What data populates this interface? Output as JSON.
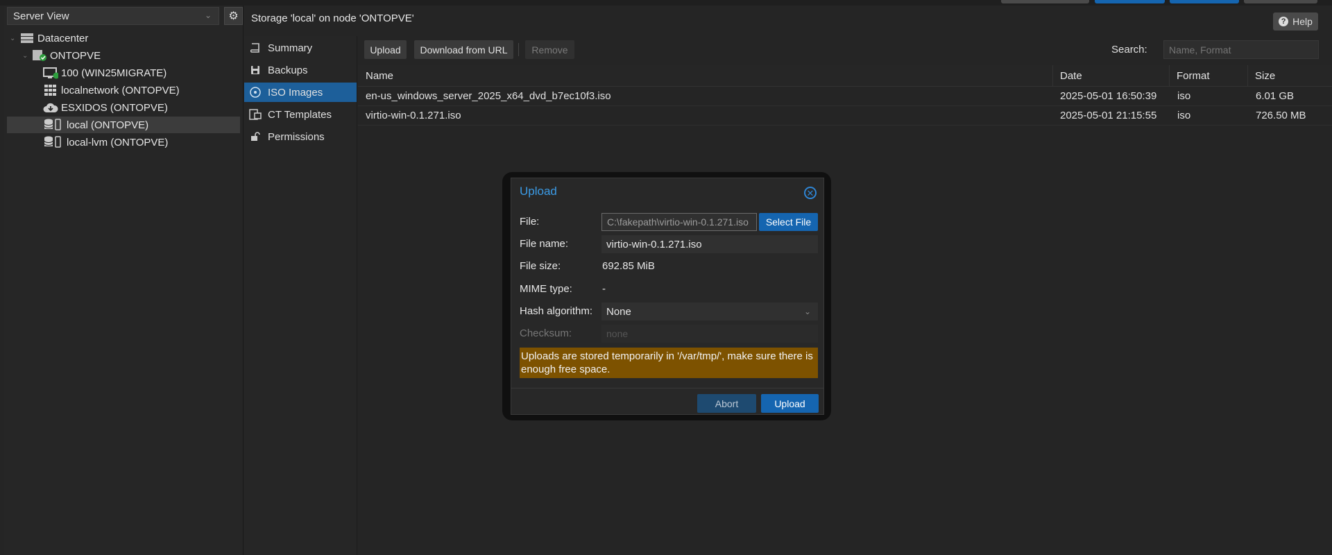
{
  "left_panel": {
    "view_select": "Server View",
    "tree": [
      {
        "label": "Datacenter",
        "icon": "datacenter-icon"
      },
      {
        "label": "ONTOPVE",
        "icon": "node-online-icon"
      },
      {
        "label": "100 (WIN25MIGRATE)",
        "icon": "vm-running-icon"
      },
      {
        "label": "localnetwork (ONTOPVE)",
        "icon": "grid-network-icon"
      },
      {
        "label": "ESXIDOS (ONTOPVE)",
        "icon": "cloud-storage-icon"
      },
      {
        "label": "local (ONTOPVE)",
        "icon": "storage-icon"
      },
      {
        "label": "local-lvm (ONTOPVE)",
        "icon": "storage-icon"
      }
    ]
  },
  "content": {
    "title": "Storage 'local' on node 'ONTOPVE'",
    "help_label": "Help",
    "nav": [
      {
        "label": "Summary",
        "icon": "book-icon"
      },
      {
        "label": "Backups",
        "icon": "floppy-icon"
      },
      {
        "label": "ISO Images",
        "icon": "disc-icon"
      },
      {
        "label": "CT Templates",
        "icon": "template-icon"
      },
      {
        "label": "Permissions",
        "icon": "unlock-icon"
      }
    ],
    "toolbar": {
      "upload": "Upload",
      "download_url": "Download from URL",
      "remove": "Remove",
      "search_label": "Search:",
      "search_placeholder": "Name, Format"
    },
    "grid": {
      "columns": [
        "Name",
        "Date",
        "Format",
        "Size"
      ],
      "rows": [
        {
          "name": "en-us_windows_server_2025_x64_dvd_b7ec10f3.iso",
          "date": "2025-05-01 16:50:39",
          "format": "iso",
          "size": "6.01 GB"
        },
        {
          "name": "virtio-win-0.1.271.iso",
          "date": "2025-05-01 21:15:55",
          "format": "iso",
          "size": "726.50 MB"
        }
      ]
    }
  },
  "dialog": {
    "title": "Upload",
    "file_label": "File:",
    "file_value": "C:\\fakepath\\virtio-win-0.1.271.iso",
    "select_file": "Select File",
    "filename_label": "File name:",
    "filename_value": "virtio-win-0.1.271.iso",
    "filesize_label": "File size:",
    "filesize_value": "692.85 MiB",
    "mime_label": "MIME type:",
    "mime_value": "-",
    "hash_label": "Hash algorithm:",
    "hash_value": "None",
    "checksum_label": "Checksum:",
    "checksum_placeholder": "none",
    "warning": "Uploads are stored temporarily in '/var/tmp/', make sure there is enough free space.",
    "abort": "Abort",
    "upload": "Upload"
  },
  "colors": {
    "accent": "#1565b0",
    "active_nav": "#1d5f9a",
    "warning_bg": "#7d5200",
    "title_blue": "#3b9be6"
  }
}
